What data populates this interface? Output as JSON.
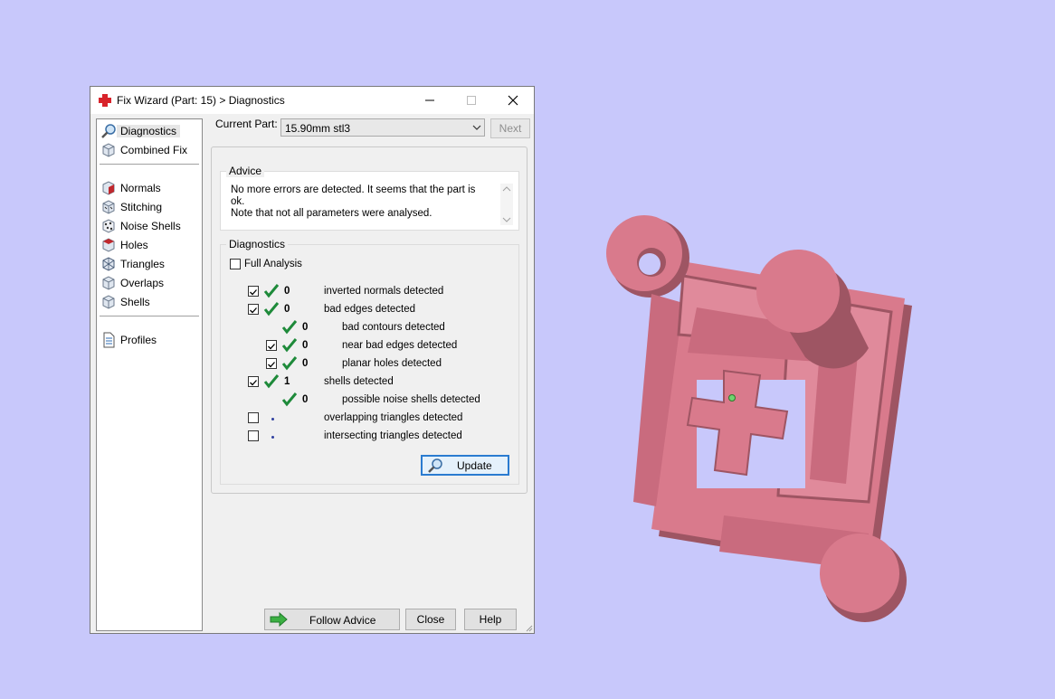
{
  "window": {
    "title": "Fix Wizard (Part: 15) > Diagnostics",
    "title_icon": "red-cross-icon",
    "controls": [
      "minimize-icon",
      "maximize-icon",
      "close-icon"
    ]
  },
  "sidebar": {
    "items": [
      {
        "label": "Diagnostics",
        "icon": "magnifier-icon",
        "selected": true
      },
      {
        "label": "Combined Fix",
        "icon": "cube-icon"
      },
      {
        "label": "Normals",
        "icon": "normals-cube-icon"
      },
      {
        "label": "Stitching",
        "icon": "stitching-cube-icon"
      },
      {
        "label": "Noise Shells",
        "icon": "noise-shells-icon"
      },
      {
        "label": "Holes",
        "icon": "holes-cube-icon"
      },
      {
        "label": "Triangles",
        "icon": "triangles-cube-icon"
      },
      {
        "label": "Overlaps",
        "icon": "overlaps-cube-icon"
      },
      {
        "label": "Shells",
        "icon": "shells-cube-icon"
      },
      {
        "label": "Profiles",
        "icon": "document-icon"
      }
    ]
  },
  "current_part": {
    "label": "Current Part:",
    "value": "15.90mm stl3",
    "next_label": "Next"
  },
  "advice": {
    "title": "Advice",
    "line1": "No more errors are detected. It seems that the part is ok.",
    "line2": "Note that not all parameters were analysed."
  },
  "diagnostics": {
    "title": "Diagnostics",
    "full_analysis_label": "Full Analysis",
    "full_analysis_checked": false,
    "rows": [
      {
        "checked": true,
        "checkbox": true,
        "status": "ok",
        "count": "0",
        "label": "inverted normals detected"
      },
      {
        "checked": true,
        "checkbox": true,
        "status": "ok",
        "count": "0",
        "label": "bad edges detected"
      },
      {
        "checked": false,
        "checkbox": false,
        "status": "ok",
        "count": "0",
        "label": "bad contours detected"
      },
      {
        "checked": true,
        "checkbox": true,
        "status": "ok",
        "count": "0",
        "label": "near bad edges detected"
      },
      {
        "checked": true,
        "checkbox": true,
        "status": "ok",
        "count": "0",
        "label": "planar holes detected"
      },
      {
        "checked": true,
        "checkbox": true,
        "status": "ok",
        "count": "1",
        "label": "shells detected"
      },
      {
        "checked": false,
        "checkbox": false,
        "status": "ok",
        "count": "0",
        "label": "possible noise shells detected"
      },
      {
        "checked": false,
        "checkbox": true,
        "status": "pending",
        "count": "",
        "label": "overlapping triangles detected"
      },
      {
        "checked": false,
        "checkbox": true,
        "status": "pending",
        "count": "",
        "label": "intersecting triangles detected"
      }
    ],
    "update_label": "Update"
  },
  "footer": {
    "follow_advice_label": "Follow Advice",
    "close_label": "Close",
    "help_label": "Help"
  },
  "colors": {
    "background": "#c8c8fb",
    "model": "#d97a8c",
    "check_green": "#1e8a3a"
  }
}
